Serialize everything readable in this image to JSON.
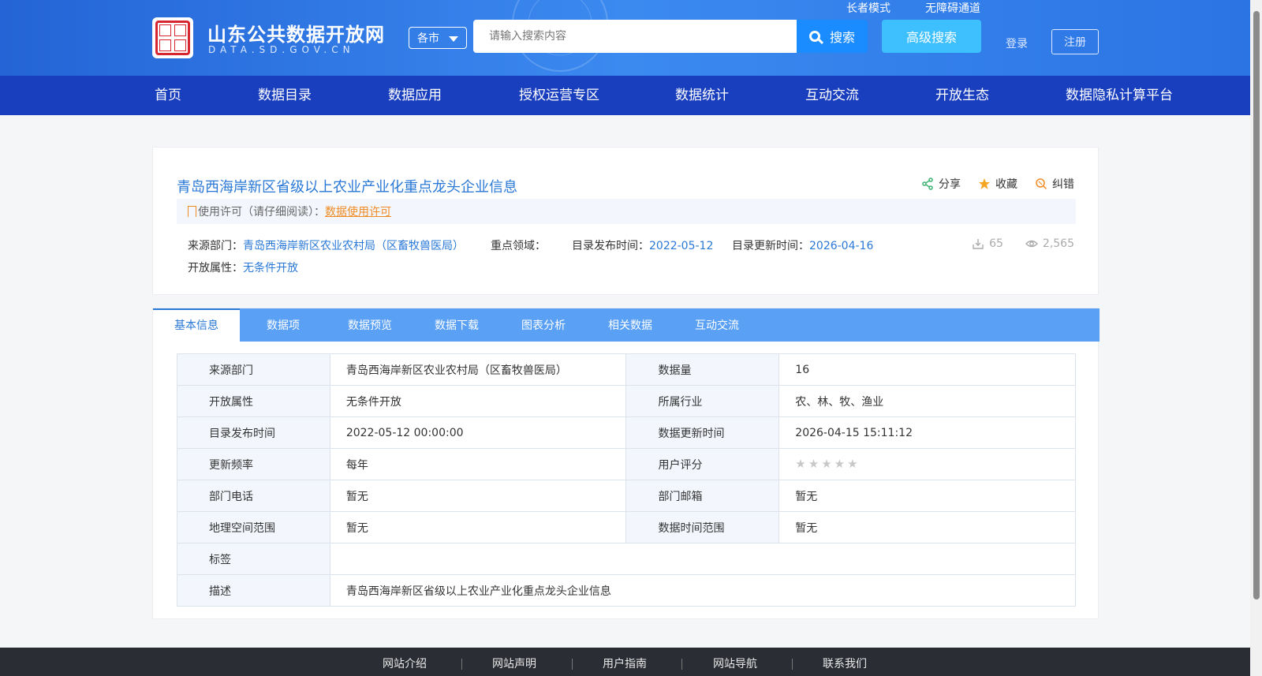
{
  "header": {
    "site_title": "山东公共数据开放网",
    "site_domain": "DATA.SD.GOV.CN",
    "region": "各市",
    "search_placeholder": "请输入搜索内容",
    "search_label": "搜索",
    "advanced_search_label": "高级搜索",
    "elder_mode": "长者模式",
    "accessibility": "无障碍通道",
    "login": "登录",
    "register": "注册"
  },
  "nav": {
    "items": [
      "首页",
      "数据目录",
      "数据应用",
      "授权运营专区",
      "数据统计",
      "互动交流",
      "开放生态",
      "数据隐私计算平台"
    ]
  },
  "dataset": {
    "title": "青岛西海岸新区省级以上农业产业化重点龙头企业信息",
    "actions": {
      "share": "分享",
      "favorite": "收藏",
      "report": "纠错"
    },
    "license_prefix": "使用许可（请仔细阅读）：",
    "license_link": "数据使用许可",
    "source_label": "来源部门：",
    "source_value": "青岛西海岸新区农业农村局（区畜牧兽医局）",
    "domain_label": "重点领域：",
    "publish_label": "目录发布时间：",
    "publish_value": "2022-05-12",
    "update_label": "目录更新时间：",
    "update_value": "2026-04-16",
    "open_label": "开放属性：",
    "open_value": "无条件开放",
    "downloads": "65",
    "views": "2,565"
  },
  "tabs": [
    "基本信息",
    "数据项",
    "数据预览",
    "数据下载",
    "图表分析",
    "相关数据",
    "互动交流"
  ],
  "table": {
    "rows": [
      {
        "k1": "来源部门",
        "v1": "青岛西海岸新区农业农村局（区畜牧兽医局）",
        "k2": "数据量",
        "v2": "16"
      },
      {
        "k1": "开放属性",
        "v1": "无条件开放",
        "k2": "所属行业",
        "v2": "农、林、牧、渔业"
      },
      {
        "k1": "目录发布时间",
        "v1": "2022-05-12 00:00:00",
        "k2": "数据更新时间",
        "v2": "2026-04-15 15:11:12"
      },
      {
        "k1": "更新频率",
        "v1": "每年",
        "k2": "用户评分",
        "rating": 0
      },
      {
        "k1": "部门电话",
        "v1": "暂无",
        "k2": "部门邮箱",
        "v2": "暂无"
      },
      {
        "k1": "地理空间范围",
        "v1": "暂无",
        "k2": "数据时间范围",
        "v2": "暂无"
      }
    ],
    "tag_label": "标签",
    "tag_value": "",
    "desc_label": "描述",
    "desc_value": "青岛西海岸新区省级以上农业产业化重点龙头企业信息"
  },
  "footer": {
    "links": [
      "网站介绍",
      "网站声明",
      "用户指南",
      "网站导航",
      "联系我们"
    ]
  },
  "colors": {
    "accent": "#2a78d6",
    "nav_bg": "#1a3fbe",
    "tab_bg": "#5aa0f5",
    "license": "#f08a24"
  },
  "icons": {
    "share": "share-icon",
    "favorite": "star-icon",
    "report": "report-icon",
    "download": "download-icon",
    "views": "eye-icon"
  }
}
